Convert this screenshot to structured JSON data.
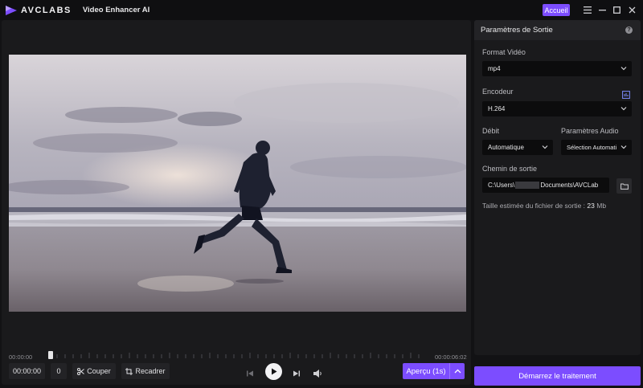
{
  "titlebar": {
    "brand": "AVCLABS",
    "app_name": "Video Enhancer AI",
    "home_button": "Accueil"
  },
  "timeline": {
    "current_time": "00:00:00",
    "total_time": "00:00:06:02",
    "position": 0.0
  },
  "controls": {
    "time_value": "00:00:00",
    "frame_value": "0",
    "cut_label": "Couper",
    "crop_label": "Recadrer",
    "preview_label": "Aperçu (1s)"
  },
  "settings": {
    "title": "Paramètres de Sortie",
    "format_label": "Format Vidéo",
    "format_value": "mp4",
    "encoder_label": "Encodeur",
    "encoder_value": "H.264",
    "bitrate_label": "Débit",
    "bitrate_value": "Automatique",
    "audio_label": "Paramètres Audio",
    "audio_value": "Sélection Automati",
    "path_label": "Chemin de sortie",
    "path_value_prefix": "C:\\Users\\",
    "path_value_suffix": "Documents\\AVCLab",
    "size_prefix": "Taille estimée du fichier de sortie :",
    "size_value": "23",
    "size_unit": "Mb"
  },
  "start_button": "Démarrez le traitement",
  "icons": {
    "logo": "avclabs-logo-icon",
    "menu": "menu-icon",
    "minimize": "minimize-icon",
    "maximize": "maximize-icon",
    "close": "close-icon",
    "help": "help-icon",
    "encoder_settings": "settings-sliders-icon",
    "folder": "folder-icon",
    "prev": "skip-back-icon",
    "play": "play-icon",
    "next": "skip-forward-icon",
    "volume": "volume-icon"
  },
  "colors": {
    "accent": "#7c4dff",
    "background": "#121214",
    "panel": "#1a1a1c"
  }
}
